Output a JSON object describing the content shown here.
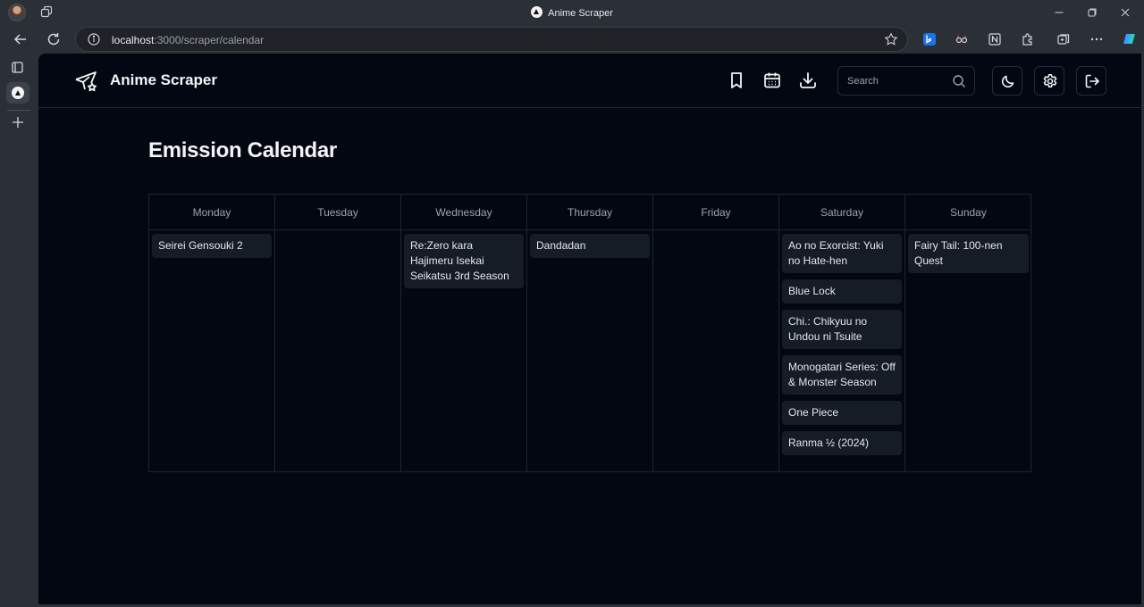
{
  "browser": {
    "window_title": "Anime Scraper",
    "url_host": "localhost",
    "url_rest": ":3000/scraper/calendar"
  },
  "app": {
    "brand": "Anime Scraper",
    "search_placeholder": "Search",
    "page_title": "Emission Calendar"
  },
  "calendar": {
    "days": [
      {
        "name": "Monday",
        "entries": [
          "Seirei Gensouki 2"
        ]
      },
      {
        "name": "Tuesday",
        "entries": []
      },
      {
        "name": "Wednesday",
        "entries": [
          "Re:Zero kara Hajimeru Isekai Seikatsu 3rd Season"
        ]
      },
      {
        "name": "Thursday",
        "entries": [
          "Dandadan"
        ]
      },
      {
        "name": "Friday",
        "entries": []
      },
      {
        "name": "Saturday",
        "entries": [
          "Ao no Exorcist: Yuki no Hate-hen",
          "Blue Lock",
          "Chi.: Chikyuu no Undou ni Tsuite",
          "Monogatari Series: Off & Monster Season",
          "One Piece",
          "Ranma ½ (2024)"
        ]
      },
      {
        "name": "Sunday",
        "entries": [
          "Fairy Tail: 100-nen Quest"
        ]
      }
    ]
  },
  "icons": {
    "header": [
      "bookmark-icon",
      "calendar-icon",
      "download-icon",
      "search-icon",
      "moon-icon",
      "settings-icon",
      "logout-icon"
    ]
  }
}
